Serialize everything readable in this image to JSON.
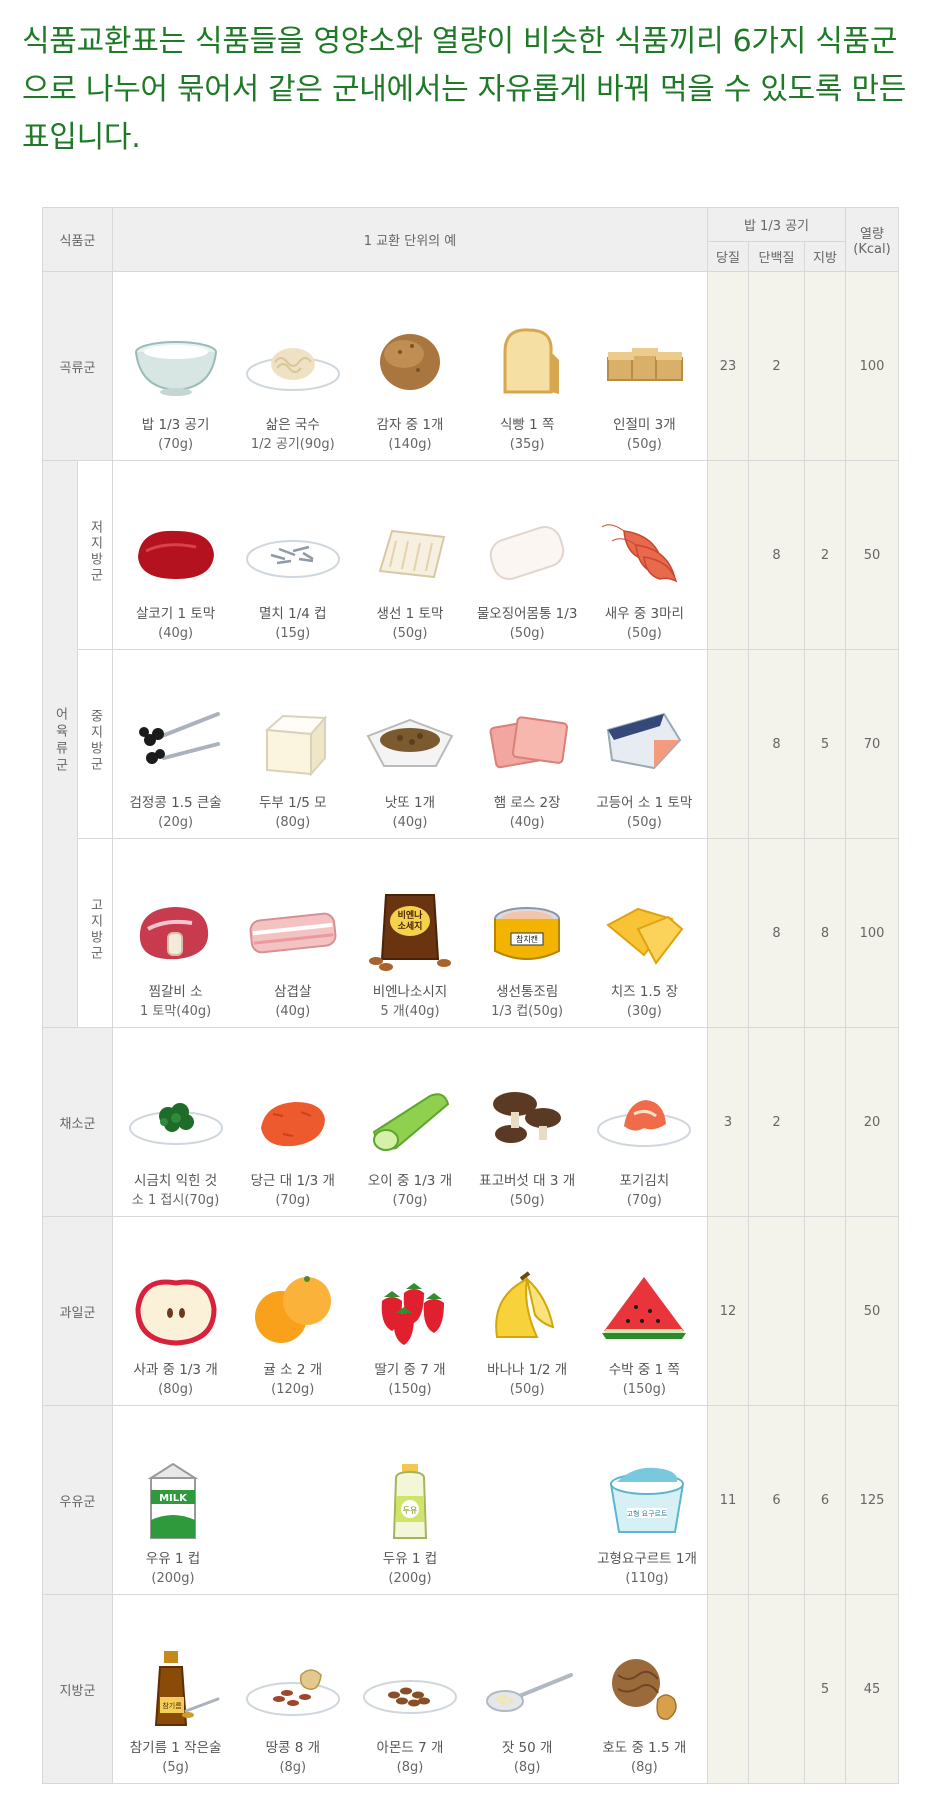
{
  "intro": "식품교환표는 식품들을 영양소와 열량이 비슷한 식품끼리 6가지 식품군으로 나누어 묶어서 같은 군내에서는 자유롭게 바꿔 먹을 수 있도록 만든 표입니다.",
  "header": {
    "group": "식품군",
    "examples": "1 교환 단위의 예",
    "rice_third": "밥 1/3 공기",
    "calories": "열량",
    "kcal": "(Kcal)",
    "carb": "당질",
    "protein": "단백질",
    "fat": "지방"
  },
  "meat_group": "어육류군",
  "rows": [
    {
      "group": "곡류군",
      "subgroup": "",
      "carb": "23",
      "protein": "2",
      "fat": "",
      "kcal": "100",
      "foods": [
        {
          "icon": "rice-bowl",
          "name": "밥 1/3 공기",
          "amount": "(70g)"
        },
        {
          "icon": "noodles-plate",
          "name": "삶은 국수",
          "amount": "1/2 공기(90g)"
        },
        {
          "icon": "potato",
          "name": "감자 중 1개",
          "amount": "(140g)"
        },
        {
          "icon": "bread-slice",
          "name": "식빵 1 쪽",
          "amount": "(35g)"
        },
        {
          "icon": "injeolmi",
          "name": "인절미 3개",
          "amount": "(50g)"
        }
      ]
    },
    {
      "group": "",
      "subgroup": "저지방군",
      "carb": "",
      "protein": "8",
      "fat": "2",
      "kcal": "50",
      "foods": [
        {
          "icon": "beef",
          "name": "살코기 1 토막",
          "amount": "(40g)"
        },
        {
          "icon": "anchovy-plate",
          "name": "멸치 1/4 컵",
          "amount": "(15g)"
        },
        {
          "icon": "fish-fillet",
          "name": "생선 1 토막",
          "amount": "(50g)"
        },
        {
          "icon": "squid-body",
          "name": "물오징어몸통 1/3",
          "amount": "(50g)"
        },
        {
          "icon": "shrimp",
          "name": "새우 중 3마리",
          "amount": "(50g)"
        }
      ]
    },
    {
      "group": "",
      "subgroup": "중지방군",
      "carb": "",
      "protein": "8",
      "fat": "5",
      "kcal": "70",
      "foods": [
        {
          "icon": "black-beans",
          "name": "검정콩 1.5 큰술",
          "amount": "(20g)"
        },
        {
          "icon": "tofu",
          "name": "두부 1/5 모",
          "amount": "(80g)"
        },
        {
          "icon": "natto",
          "name": "낫또 1개",
          "amount": "(40g)"
        },
        {
          "icon": "ham",
          "name": "햄 로스 2장",
          "amount": "(40g)"
        },
        {
          "icon": "mackerel",
          "name": "고등어 소 1 토막",
          "amount": "(50g)"
        }
      ]
    },
    {
      "group": "",
      "subgroup": "고지방군",
      "carb": "",
      "protein": "8",
      "fat": "8",
      "kcal": "100",
      "foods": [
        {
          "icon": "galbi",
          "name": "찜갈비 소",
          "amount": "1 토막(40g)"
        },
        {
          "icon": "pork-belly",
          "name": "삼겹살",
          "amount": "(40g)"
        },
        {
          "icon": "sausage-pack",
          "name": "비엔나소시지",
          "amount": "5 개(40g)",
          "label": "비엔나 소세지"
        },
        {
          "icon": "tuna-can",
          "name": "생선통조림",
          "amount": "1/3 컵(50g)",
          "label": "참치캔"
        },
        {
          "icon": "cheese",
          "name": "치즈 1.5 장",
          "amount": "(30g)"
        }
      ]
    },
    {
      "group": "채소군",
      "subgroup": "",
      "carb": "3",
      "protein": "2",
      "fat": "",
      "kcal": "20",
      "foods": [
        {
          "icon": "spinach-plate",
          "name": "시금치 익힌 것",
          "amount": "소 1 접시(70g)"
        },
        {
          "icon": "carrot",
          "name": "당근 대 1/3 개",
          "amount": "(70g)"
        },
        {
          "icon": "cucumber",
          "name": "오이 중 1/3 개",
          "amount": "(70g)"
        },
        {
          "icon": "shiitake",
          "name": "표고버섯 대 3 개",
          "amount": "(50g)"
        },
        {
          "icon": "kimchi-plate",
          "name": "포기김치",
          "amount": "(70g)"
        }
      ]
    },
    {
      "group": "과일군",
      "subgroup": "",
      "carb": "12",
      "protein": "",
      "fat": "",
      "kcal": "50",
      "foods": [
        {
          "icon": "apple-half",
          "name": "사과 중 1/3 개",
          "amount": "(80g)"
        },
        {
          "icon": "tangerine",
          "name": "귤 소 2 개",
          "amount": "(120g)"
        },
        {
          "icon": "strawberry",
          "name": "딸기 중 7 개",
          "amount": "(150g)"
        },
        {
          "icon": "banana",
          "name": "바나나 1/2 개",
          "amount": "(50g)"
        },
        {
          "icon": "watermelon",
          "name": "수박 중 1 쪽",
          "amount": "(150g)"
        }
      ]
    },
    {
      "group": "우유군",
      "subgroup": "",
      "carb": "11",
      "protein": "6",
      "fat": "6",
      "kcal": "125",
      "foods": [
        {
          "icon": "milk-carton",
          "name": "우유 1 컵",
          "amount": "(200g)",
          "label": "MILK"
        },
        {
          "icon": "soymilk-bottle",
          "name": "두유 1 컵",
          "amount": "(200g)",
          "label": "두유"
        },
        {
          "icon": "yogurt-cup",
          "name": "고형요구르트 1개",
          "amount": "(110g)",
          "label": "고형 요구르트"
        }
      ]
    },
    {
      "group": "지방군",
      "subgroup": "",
      "carb": "",
      "protein": "",
      "fat": "5",
      "kcal": "45",
      "foods": [
        {
          "icon": "sesame-oil",
          "name": "참기름 1 작은술",
          "amount": "(5g)",
          "label": "참기름"
        },
        {
          "icon": "peanut-plate",
          "name": "땅콩 8 개",
          "amount": "(8g)"
        },
        {
          "icon": "almond-plate",
          "name": "아몬드 7 개",
          "amount": "(8g)"
        },
        {
          "icon": "pine-nut-spoon",
          "name": "잣 50 개",
          "amount": "(8g)"
        },
        {
          "icon": "walnut",
          "name": "호도 중 1.5 개",
          "amount": "(8g)"
        }
      ]
    }
  ]
}
